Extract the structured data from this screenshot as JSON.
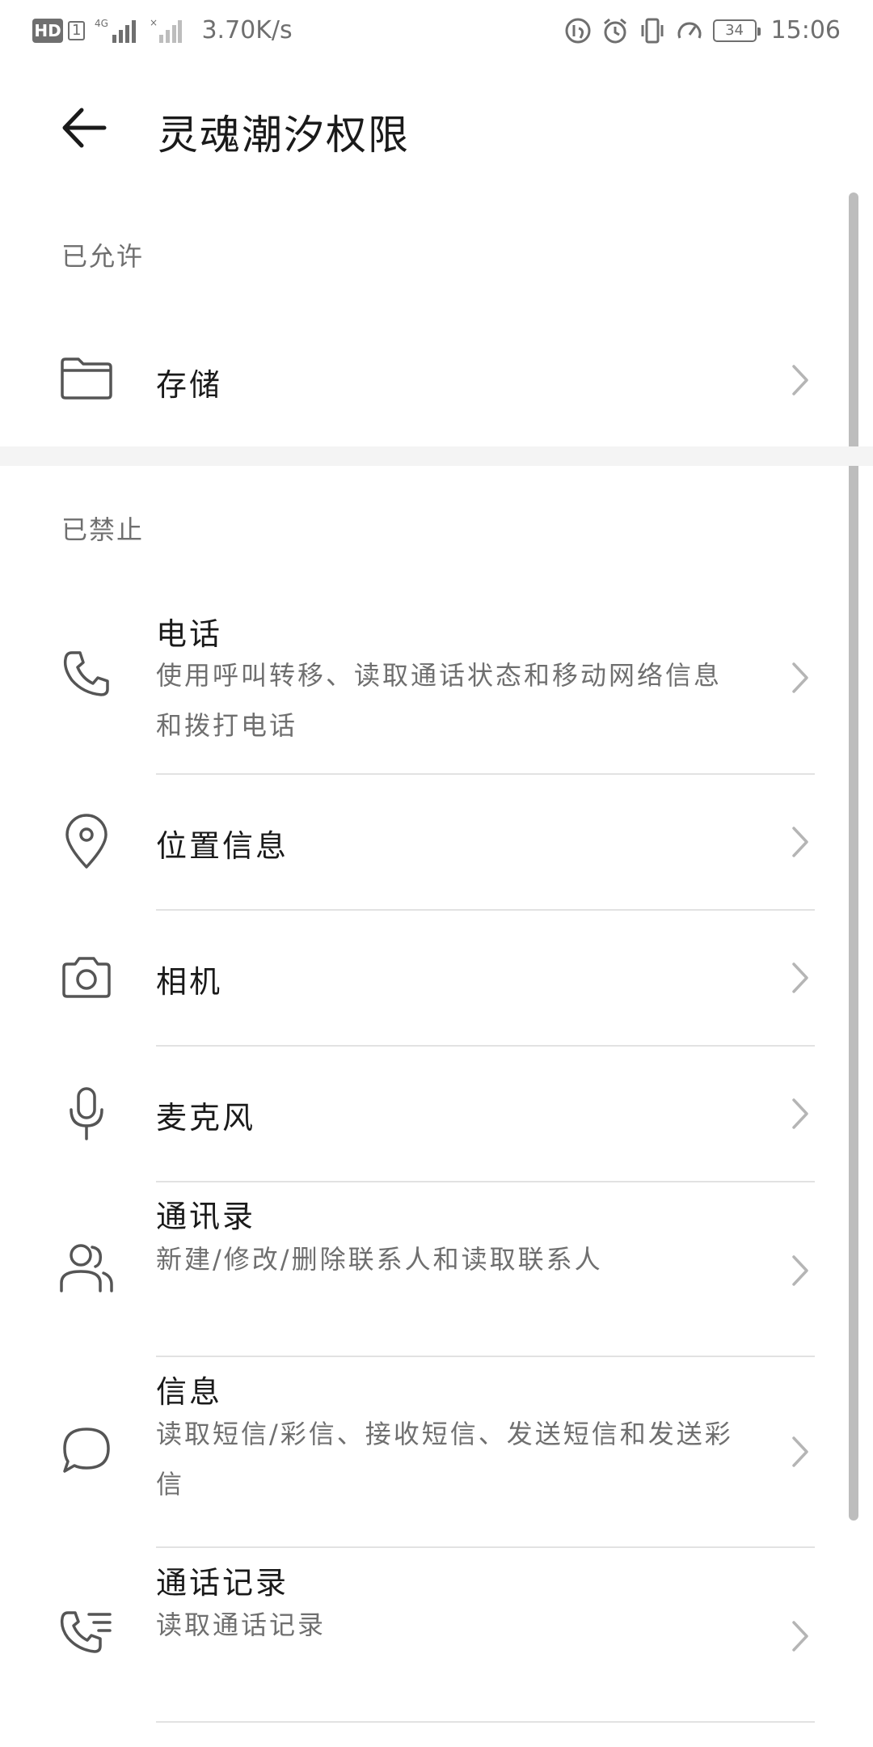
{
  "status_bar": {
    "hd_label": "HD",
    "sim_label": "1",
    "network_label": "4G",
    "net_speed": "3.70K/s",
    "battery_level": "34",
    "time": "15:06"
  },
  "app_bar": {
    "title": "灵魂潮汐权限"
  },
  "sections": {
    "allowed_header": "已允许",
    "denied_header": "已禁止"
  },
  "allowed_items": [
    {
      "title": "存储",
      "icon": "folder-icon"
    }
  ],
  "denied_items": [
    {
      "title": "电话",
      "desc": "使用呼叫转移、读取通话状态和移动网络信息和拨打电话",
      "icon": "phone-icon"
    },
    {
      "title": "位置信息",
      "icon": "location-pin-icon"
    },
    {
      "title": "相机",
      "icon": "camera-icon"
    },
    {
      "title": "麦克风",
      "icon": "microphone-icon"
    },
    {
      "title": "通讯录",
      "desc": "新建/修改/删除联系人和读取联系人",
      "icon": "contacts-icon"
    },
    {
      "title": "信息",
      "desc": "读取短信/彩信、接收短信、发送短信和发送彩信",
      "icon": "message-icon"
    },
    {
      "title": "通话记录",
      "desc": "读取通话记录",
      "icon": "call-log-icon"
    }
  ],
  "colors": {
    "text_primary": "#1a1a1a",
    "text_secondary": "#6f6f6f",
    "divider": "#e2e2e2",
    "section_gap": "#f4f4f4"
  }
}
